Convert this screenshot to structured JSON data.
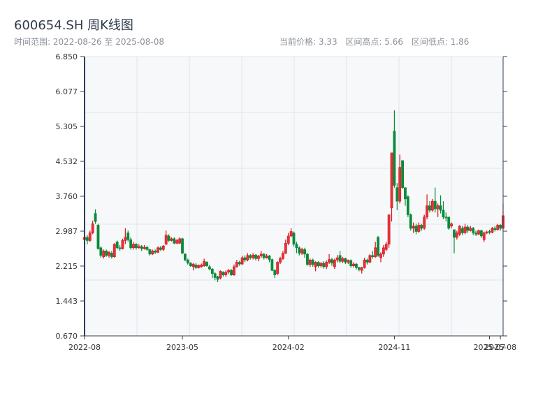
{
  "header": {
    "title": "600654.SH 周K线图",
    "range_label": "时间范围: 2022-08-26 至 2025-08-08",
    "current_price": "当前价格: 3.33",
    "range_high": "区间高点: 5.66",
    "range_low": "区间低点: 1.86"
  },
  "chart_data": {
    "type": "candlestick",
    "title": "600654.SH 周K线图",
    "ylim": [
      0.67,
      6.85
    ],
    "y_tick_labels": [
      "6.850",
      "6.077",
      "5.305",
      "4.532",
      "3.760",
      "2.987",
      "2.215",
      "1.443",
      "0.670"
    ],
    "x_tick_labels": [
      "2022-08",
      "2023-05",
      "2024-02",
      "2024-11",
      "2025-07",
      "2025-08"
    ],
    "grid": true,
    "colors": {
      "up": "#d7141a",
      "down": "#0b8a3a",
      "plot_bg": "#f6f8fa",
      "grid": "#e3e6ea",
      "axis": "#2f3f55"
    },
    "fields": [
      "date",
      "open",
      "close",
      "low",
      "high"
    ],
    "candles": [
      [
        "2022-08-26",
        2.8,
        2.85,
        2.75,
        2.9
      ],
      [
        "2022-09-02",
        2.85,
        2.78,
        2.7,
        2.9
      ],
      [
        "2022-09-09",
        2.78,
        2.95,
        2.75,
        3.0
      ],
      [
        "2022-09-16",
        2.95,
        3.15,
        2.92,
        3.22
      ],
      [
        "2022-09-23",
        3.38,
        3.2,
        3.15,
        3.47
      ],
      [
        "2022-09-30",
        3.12,
        2.6,
        2.58,
        3.15
      ],
      [
        "2022-10-07",
        2.62,
        2.45,
        2.4,
        2.65
      ],
      [
        "2022-10-14",
        2.42,
        2.55,
        2.38,
        2.58
      ],
      [
        "2022-10-21",
        2.55,
        2.45,
        2.42,
        2.58
      ],
      [
        "2022-10-28",
        2.45,
        2.52,
        2.4,
        2.55
      ],
      [
        "2022-11-04",
        2.5,
        2.42,
        2.38,
        2.55
      ],
      [
        "2022-11-11",
        2.42,
        2.7,
        2.4,
        2.72
      ],
      [
        "2022-11-18",
        2.75,
        2.62,
        2.58,
        2.78
      ],
      [
        "2022-11-25",
        2.62,
        2.6,
        2.55,
        2.68
      ],
      [
        "2022-12-02",
        2.6,
        2.78,
        2.58,
        2.82
      ],
      [
        "2022-12-09",
        2.78,
        2.85,
        2.7,
        3.05
      ],
      [
        "2022-12-16",
        2.95,
        2.8,
        2.75,
        3.0
      ],
      [
        "2022-12-23",
        2.8,
        2.62,
        2.58,
        2.85
      ],
      [
        "2022-12-30",
        2.62,
        2.7,
        2.58,
        2.75
      ],
      [
        "2023-01-06",
        2.7,
        2.62,
        2.58,
        2.72
      ],
      [
        "2023-01-13",
        2.62,
        2.65,
        2.6,
        2.7
      ],
      [
        "2023-01-20",
        2.65,
        2.6,
        2.55,
        2.68
      ],
      [
        "2023-01-27",
        2.6,
        2.63,
        2.58,
        2.68
      ],
      [
        "2023-02-03",
        2.63,
        2.58,
        2.55,
        2.66
      ],
      [
        "2023-02-10",
        2.58,
        2.48,
        2.45,
        2.6
      ],
      [
        "2023-02-17",
        2.48,
        2.55,
        2.46,
        2.58
      ],
      [
        "2023-02-24",
        2.55,
        2.52,
        2.48,
        2.58
      ],
      [
        "2023-03-03",
        2.52,
        2.62,
        2.5,
        2.65
      ],
      [
        "2023-03-10",
        2.62,
        2.58,
        2.55,
        2.66
      ],
      [
        "2023-03-17",
        2.58,
        2.66,
        2.55,
        2.68
      ],
      [
        "2023-03-24",
        2.7,
        2.9,
        2.68,
        3.0
      ],
      [
        "2023-03-31",
        2.88,
        2.78,
        2.75,
        2.92
      ],
      [
        "2023-04-07",
        2.78,
        2.82,
        2.76,
        2.85
      ],
      [
        "2023-04-14",
        2.82,
        2.72,
        2.7,
        2.85
      ],
      [
        "2023-04-21",
        2.72,
        2.78,
        2.7,
        2.82
      ],
      [
        "2023-04-28",
        2.72,
        2.82,
        2.7,
        2.85
      ],
      [
        "2023-05-05",
        2.82,
        2.5,
        2.48,
        2.84
      ],
      [
        "2023-05-12",
        2.48,
        2.35,
        2.32,
        2.5
      ],
      [
        "2023-05-19",
        2.35,
        2.28,
        2.25,
        2.38
      ],
      [
        "2023-05-26",
        2.28,
        2.22,
        2.2,
        2.3
      ],
      [
        "2023-06-02",
        2.2,
        2.26,
        2.12,
        2.28
      ],
      [
        "2023-06-09",
        2.24,
        2.18,
        2.15,
        2.28
      ],
      [
        "2023-06-16",
        2.18,
        2.23,
        2.16,
        2.25
      ],
      [
        "2023-06-23",
        2.2,
        2.24,
        2.18,
        2.27
      ],
      [
        "2023-06-30",
        2.22,
        2.32,
        2.2,
        2.38
      ],
      [
        "2023-07-07",
        2.3,
        2.22,
        2.2,
        2.32
      ],
      [
        "2023-07-14",
        2.2,
        2.15,
        2.12,
        2.24
      ],
      [
        "2023-07-21",
        2.15,
        2.05,
        1.95,
        2.17
      ],
      [
        "2023-07-28",
        2.05,
        1.96,
        1.9,
        2.08
      ],
      [
        "2023-08-04",
        1.98,
        1.92,
        1.86,
        2.0
      ],
      [
        "2023-08-11",
        1.95,
        2.1,
        1.92,
        2.12
      ],
      [
        "2023-08-18",
        2.08,
        2.02,
        1.98,
        2.1
      ],
      [
        "2023-08-25",
        2.02,
        2.08,
        1.98,
        2.12
      ],
      [
        "2023-09-01",
        2.08,
        2.12,
        2.04,
        2.15
      ],
      [
        "2023-09-08",
        2.12,
        2.02,
        2.0,
        2.15
      ],
      [
        "2023-09-15",
        2.02,
        2.2,
        2.0,
        2.25
      ],
      [
        "2023-09-22",
        2.2,
        2.3,
        2.18,
        2.35
      ],
      [
        "2023-09-29",
        2.3,
        2.26,
        2.22,
        2.33
      ],
      [
        "2023-10-06",
        2.26,
        2.4,
        2.24,
        2.44
      ],
      [
        "2023-10-13",
        2.4,
        2.35,
        2.3,
        2.45
      ],
      [
        "2023-10-20",
        2.35,
        2.45,
        2.32,
        2.5
      ],
      [
        "2023-10-27",
        2.45,
        2.4,
        2.36,
        2.48
      ],
      [
        "2023-11-03",
        2.4,
        2.46,
        2.36,
        2.5
      ],
      [
        "2023-11-10",
        2.46,
        2.38,
        2.34,
        2.48
      ],
      [
        "2023-11-17",
        2.38,
        2.44,
        2.32,
        2.46
      ],
      [
        "2023-11-24",
        2.44,
        2.48,
        2.4,
        2.55
      ],
      [
        "2023-12-01",
        2.48,
        2.4,
        2.36,
        2.5
      ],
      [
        "2023-12-08",
        2.4,
        2.44,
        2.38,
        2.48
      ],
      [
        "2023-12-15",
        2.44,
        2.36,
        2.3,
        2.46
      ],
      [
        "2023-12-22",
        2.36,
        2.12,
        2.1,
        2.38
      ],
      [
        "2023-12-29",
        2.12,
        2.02,
        1.95,
        2.15
      ],
      [
        "2024-01-05",
        2.05,
        2.3,
        2.02,
        2.32
      ],
      [
        "2024-01-12",
        2.3,
        2.38,
        2.26,
        2.42
      ],
      [
        "2024-01-19",
        2.38,
        2.5,
        2.35,
        2.55
      ],
      [
        "2024-01-26",
        2.5,
        2.72,
        2.48,
        2.8
      ],
      [
        "2024-02-02",
        2.72,
        2.88,
        2.68,
        2.95
      ],
      [
        "2024-02-09",
        2.88,
        2.98,
        2.85,
        3.05
      ],
      [
        "2024-02-16",
        2.95,
        2.7,
        2.65,
        2.98
      ],
      [
        "2024-02-23",
        2.7,
        2.62,
        2.5,
        2.75
      ],
      [
        "2024-03-01",
        2.62,
        2.5,
        2.45,
        2.65
      ],
      [
        "2024-03-08",
        2.5,
        2.58,
        2.46,
        2.62
      ],
      [
        "2024-03-15",
        2.58,
        2.48,
        2.4,
        2.62
      ],
      [
        "2024-03-22",
        2.48,
        2.25,
        2.22,
        2.5
      ],
      [
        "2024-03-29",
        2.25,
        2.35,
        2.2,
        2.38
      ],
      [
        "2024-04-05",
        2.35,
        2.25,
        2.2,
        2.38
      ],
      [
        "2024-04-12",
        2.2,
        2.3,
        2.1,
        2.32
      ],
      [
        "2024-04-19",
        2.3,
        2.22,
        2.18,
        2.32
      ],
      [
        "2024-04-26",
        2.22,
        2.28,
        2.18,
        2.3
      ],
      [
        "2024-05-03",
        2.28,
        2.2,
        2.16,
        2.32
      ],
      [
        "2024-05-10",
        2.2,
        2.3,
        2.15,
        2.34
      ],
      [
        "2024-05-17",
        2.3,
        2.36,
        2.26,
        2.48
      ],
      [
        "2024-05-24",
        2.36,
        2.28,
        2.22,
        2.4
      ],
      [
        "2024-05-31",
        2.2,
        2.35,
        2.15,
        2.38
      ],
      [
        "2024-06-07",
        2.35,
        2.4,
        2.3,
        2.46
      ],
      [
        "2024-06-14",
        2.45,
        2.32,
        2.28,
        2.55
      ],
      [
        "2024-06-21",
        2.32,
        2.38,
        2.28,
        2.42
      ],
      [
        "2024-06-28",
        2.38,
        2.3,
        2.26,
        2.4
      ],
      [
        "2024-07-05",
        2.3,
        2.34,
        2.26,
        2.36
      ],
      [
        "2024-07-12",
        2.34,
        2.22,
        2.18,
        2.36
      ],
      [
        "2024-07-19",
        2.22,
        2.26,
        2.18,
        2.3
      ],
      [
        "2024-07-26",
        2.26,
        2.18,
        2.14,
        2.28
      ],
      [
        "2024-08-02",
        2.18,
        2.14,
        2.1,
        2.2
      ],
      [
        "2024-08-09",
        2.12,
        2.18,
        2.05,
        2.2
      ],
      [
        "2024-08-16",
        2.18,
        2.35,
        2.16,
        2.4
      ],
      [
        "2024-08-23",
        2.35,
        2.3,
        2.25,
        2.38
      ],
      [
        "2024-08-30",
        2.3,
        2.45,
        2.28,
        2.48
      ],
      [
        "2024-09-06",
        2.45,
        2.42,
        2.38,
        2.55
      ],
      [
        "2024-09-13",
        2.42,
        2.62,
        2.4,
        2.75
      ],
      [
        "2024-09-20",
        2.85,
        2.45,
        2.42,
        2.88
      ],
      [
        "2024-09-27",
        2.4,
        2.48,
        2.3,
        2.52
      ],
      [
        "2024-10-04",
        2.48,
        2.62,
        2.42,
        2.68
      ],
      [
        "2024-10-11",
        2.58,
        2.7,
        2.55,
        2.75
      ],
      [
        "2024-10-18",
        2.7,
        3.35,
        2.62,
        3.35
      ],
      [
        "2024-10-25",
        3.5,
        4.72,
        3.2,
        4.72
      ],
      [
        "2024-11-01",
        5.2,
        4.0,
        3.95,
        5.66
      ],
      [
        "2024-11-08",
        3.95,
        3.65,
        3.45,
        4.05
      ],
      [
        "2024-11-15",
        3.65,
        4.4,
        3.6,
        4.68
      ],
      [
        "2024-11-22",
        4.55,
        3.95,
        3.92,
        4.55
      ],
      [
        "2024-11-29",
        3.95,
        3.7,
        3.55,
        3.95
      ],
      [
        "2024-12-06",
        3.75,
        3.35,
        3.3,
        3.78
      ],
      [
        "2024-12-13",
        3.35,
        3.05,
        3.0,
        3.38
      ],
      [
        "2024-12-20",
        3.05,
        3.1,
        2.95,
        3.18
      ],
      [
        "2024-12-27",
        3.1,
        2.98,
        2.92,
        3.15
      ],
      [
        "2025-01-03",
        2.98,
        3.12,
        2.95,
        3.18
      ],
      [
        "2025-01-10",
        3.12,
        3.05,
        3.0,
        3.15
      ],
      [
        "2025-01-17",
        3.05,
        3.3,
        3.02,
        3.35
      ],
      [
        "2025-01-24",
        3.3,
        3.55,
        3.25,
        3.8
      ],
      [
        "2025-01-31",
        3.55,
        3.45,
        3.4,
        3.65
      ],
      [
        "2025-02-07",
        3.45,
        3.65,
        3.42,
        3.7
      ],
      [
        "2025-02-14",
        3.65,
        3.48,
        3.4,
        3.95
      ],
      [
        "2025-02-21",
        3.48,
        3.55,
        3.3,
        3.6
      ],
      [
        "2025-02-28",
        3.55,
        3.45,
        3.38,
        3.78
      ],
      [
        "2025-03-07",
        3.45,
        3.3,
        3.25,
        3.65
      ],
      [
        "2025-03-14",
        3.3,
        3.28,
        3.2,
        3.4
      ],
      [
        "2025-03-21",
        3.3,
        3.05,
        3.02,
        3.3
      ],
      [
        "2025-03-28",
        3.1,
        3.15,
        3.05,
        3.18
      ],
      [
        "2025-04-04",
        3.02,
        2.85,
        2.5,
        3.02
      ],
      [
        "2025-04-11",
        2.85,
        2.95,
        2.8,
        3.0
      ],
      [
        "2025-04-18",
        2.92,
        3.1,
        2.88,
        3.12
      ],
      [
        "2025-04-25",
        3.05,
        2.95,
        2.9,
        3.1
      ],
      [
        "2025-05-02",
        2.95,
        3.08,
        2.92,
        3.15
      ],
      [
        "2025-05-09",
        3.08,
        3.0,
        2.95,
        3.12
      ],
      [
        "2025-05-16",
        3.0,
        3.05,
        2.98,
        3.1
      ],
      [
        "2025-05-23",
        3.05,
        2.95,
        2.9,
        3.08
      ],
      [
        "2025-05-30",
        2.95,
        2.92,
        2.88,
        3.0
      ],
      [
        "2025-06-06",
        2.92,
        3.0,
        2.9,
        3.02
      ],
      [
        "2025-06-13",
        3.0,
        2.88,
        2.84,
        3.02
      ],
      [
        "2025-06-20",
        2.8,
        2.95,
        2.75,
        2.98
      ],
      [
        "2025-06-27",
        2.95,
        2.97,
        2.92,
        3.0
      ],
      [
        "2025-07-04",
        2.98,
        2.96,
        2.92,
        3.02
      ],
      [
        "2025-07-11",
        2.96,
        3.05,
        2.94,
        3.08
      ],
      [
        "2025-07-18",
        3.05,
        3.02,
        2.98,
        3.1
      ],
      [
        "2025-07-25",
        3.02,
        3.12,
        3.0,
        3.15
      ],
      [
        "2025-08-01",
        3.12,
        3.05,
        3.0,
        3.14
      ],
      [
        "2025-08-08",
        3.05,
        3.33,
        3.02,
        3.6
      ]
    ]
  }
}
